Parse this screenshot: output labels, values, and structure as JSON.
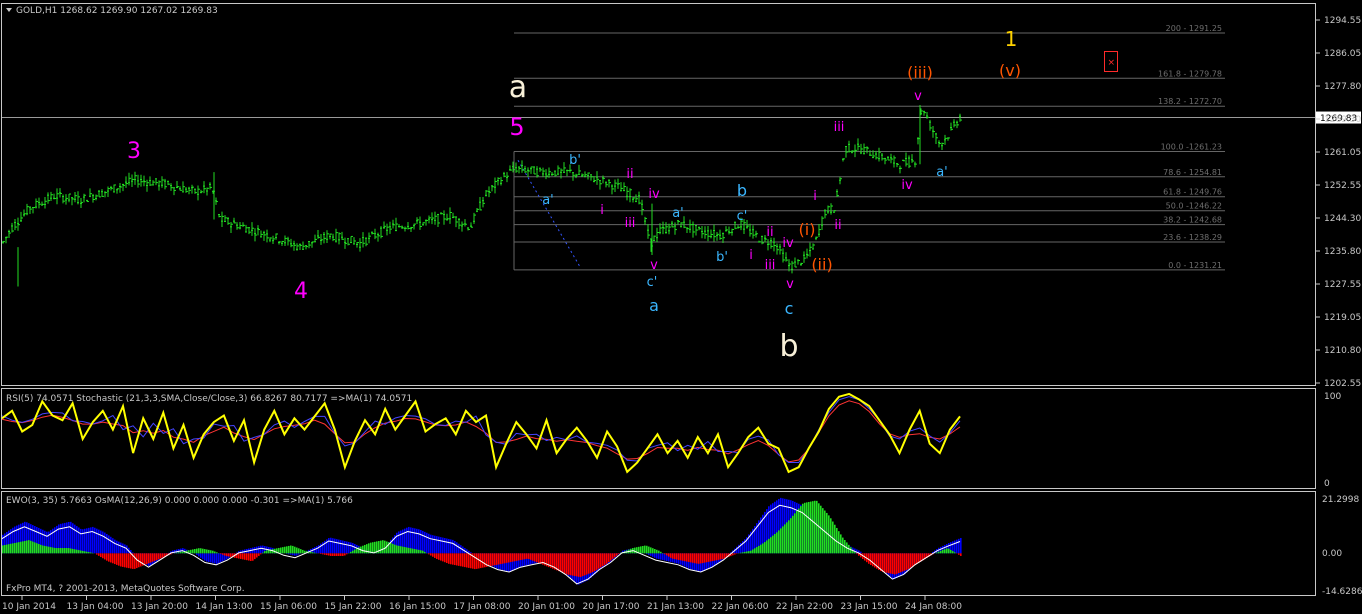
{
  "colors": {
    "background": "#000000",
    "frame": "#c8c8c8",
    "text": "#c8c8c8",
    "candle": "#22dd22",
    "fib_line": "#666666",
    "fib_text": "#6e6e6e",
    "rsi_line": "#ffff00",
    "stoch_main": "#4444ff",
    "stoch_signal": "#ff3333",
    "ewo_blue": "#0000ff",
    "ewo_green": "#22dd22",
    "ewo_red": "#ff0000",
    "ewo_line": "#ffffff",
    "magenta": "#ff00ff",
    "cyan": "#3ab6ff",
    "white": "#f8f0d8",
    "orange": "#ff5500",
    "yellow": "#ffd200",
    "close_marker": "#ff2a2a"
  },
  "symbol_header": "GOLD,H1  1268.62 1269.90 1267.02 1269.83",
  "price_axis": {
    "ticks": [
      "1294.55",
      "1286.05",
      "1277.80",
      "1269.30",
      "1261.05",
      "1252.55",
      "1244.30",
      "1235.80",
      "1227.55",
      "1219.05",
      "1210.80",
      "1202.55"
    ],
    "current_price": "1269.83"
  },
  "time_axis": [
    "10 Jan 2014",
    "13 Jan 04:00",
    "13 Jan 20:00",
    "14 Jan 13:00",
    "15 Jan 06:00",
    "15 Jan 22:00",
    "16 Jan 15:00",
    "17 Jan 08:00",
    "20 Jan 01:00",
    "20 Jan 17:00",
    "21 Jan 13:00",
    "22 Jan 06:00",
    "22 Jan 22:00",
    "23 Jan 15:00",
    "24 Jan 08:00"
  ],
  "fib_levels": [
    "200 - 1291.25",
    "161.8 - 1279.78",
    "138.2 - 1272.70",
    "100.0 -1261.23",
    "78.6 - 1254.81",
    "61.8 - 1249.76",
    "50.0 -1246.22",
    "38.2 - 1242.68",
    "23.6 - 1238.29",
    "0.0 - 1231.21"
  ],
  "wave_labels": [
    {
      "text": "3",
      "color": "magenta",
      "size": 22
    },
    {
      "text": "4",
      "color": "magenta",
      "size": 22
    },
    {
      "text": "a",
      "color": "white",
      "size": 30
    },
    {
      "text": "5",
      "color": "magenta",
      "size": 24
    },
    {
      "text": "a'",
      "color": "cyan",
      "size": 13
    },
    {
      "text": "b'",
      "color": "cyan",
      "size": 13
    },
    {
      "text": "i",
      "color": "magenta",
      "size": 13
    },
    {
      "text": "ii",
      "color": "magenta",
      "size": 13
    },
    {
      "text": "iii",
      "color": "magenta",
      "size": 13
    },
    {
      "text": "iv",
      "color": "magenta",
      "size": 13
    },
    {
      "text": "v",
      "color": "magenta",
      "size": 13
    },
    {
      "text": "c'",
      "color": "cyan",
      "size": 13
    },
    {
      "text": "a",
      "color": "cyan",
      "size": 16
    },
    {
      "text": "a'",
      "color": "cyan",
      "size": 13
    },
    {
      "text": "b",
      "color": "cyan",
      "size": 16
    },
    {
      "text": "c'",
      "color": "cyan",
      "size": 13
    },
    {
      "text": "b'",
      "color": "cyan",
      "size": 13
    },
    {
      "text": "i",
      "color": "magenta",
      "size": 13
    },
    {
      "text": "ii",
      "color": "magenta",
      "size": 13
    },
    {
      "text": "iii",
      "color": "magenta",
      "size": 13
    },
    {
      "text": "iv",
      "color": "magenta",
      "size": 13
    },
    {
      "text": "v",
      "color": "magenta",
      "size": 13
    },
    {
      "text": "c",
      "color": "cyan",
      "size": 16
    },
    {
      "text": "b",
      "color": "white",
      "size": 30
    },
    {
      "text": "(i)",
      "color": "orange",
      "size": 16
    },
    {
      "text": "(ii)",
      "color": "orange",
      "size": 16
    },
    {
      "text": "i",
      "color": "magenta",
      "size": 13
    },
    {
      "text": "ii",
      "color": "magenta",
      "size": 13
    },
    {
      "text": "iii",
      "color": "magenta",
      "size": 13
    },
    {
      "text": "iv",
      "color": "magenta",
      "size": 13
    },
    {
      "text": "v",
      "color": "magenta",
      "size": 13
    },
    {
      "text": "(iii)",
      "color": "orange",
      "size": 16
    },
    {
      "text": "a'",
      "color": "cyan",
      "size": 13
    },
    {
      "text": "1",
      "color": "yellow",
      "size": 20
    },
    {
      "text": "(v)",
      "color": "orange",
      "size": 16
    }
  ],
  "indicators": {
    "rsi_header": "RSI(5) 74.0571  Stochastic (21,3,3,SMA,Close/Close,3) 66.8267 80.7177  =>MA(1) 74.0571",
    "rsi_axis": [
      "100",
      "0"
    ],
    "ewo_header": "EWO(3, 35) 5.7663  OsMA(12,26,9) 0.000 0.000 0.000 -0.301  =>MA(1) 5.766",
    "ewo_axis": [
      "21.2998",
      "0.00",
      "-14.6286"
    ]
  },
  "copyright": "FxPro MT4, ? 2001-2013, MetaQuotes Software Corp.",
  "chart_data": {
    "type": "line",
    "title": "GOLD,H1",
    "ylim": [
      1202.55,
      1294.55
    ],
    "x": [
      "10 Jan 2014",
      "13 Jan 04:00",
      "13 Jan 20:00",
      "14 Jan 13:00",
      "15 Jan 06:00",
      "15 Jan 22:00",
      "16 Jan 15:00",
      "17 Jan 08:00",
      "20 Jan 01:00",
      "20 Jan 17:00",
      "21 Jan 13:00",
      "22 Jan 06:00",
      "22 Jan 22:00",
      "23 Jan 15:00",
      "24 Jan 08:00"
    ],
    "series": [
      {
        "name": "GOLD,H1",
        "values": [
          1237,
          1250,
          1253,
          1244,
          1238,
          1242,
          1244,
          1241,
          1256,
          1253,
          1238,
          1243,
          1233,
          1262,
          1266
        ]
      }
    ],
    "price_path": [
      [
        0,
        1237
      ],
      [
        12,
        1242
      ],
      [
        30,
        1247
      ],
      [
        55,
        1250
      ],
      [
        80,
        1249
      ],
      [
        105,
        1251
      ],
      [
        135,
        1254
      ],
      [
        165,
        1253
      ],
      [
        195,
        1251
      ],
      [
        212,
        1252
      ],
      [
        220,
        1244
      ],
      [
        245,
        1242
      ],
      [
        280,
        1239
      ],
      [
        300,
        1237
      ],
      [
        330,
        1240
      ],
      [
        360,
        1238
      ],
      [
        390,
        1242
      ],
      [
        420,
        1243
      ],
      [
        450,
        1245
      ],
      [
        470,
        1242
      ],
      [
        485,
        1250
      ],
      [
        500,
        1254
      ],
      [
        515,
        1257
      ],
      [
        540,
        1256
      ],
      [
        570,
        1256
      ],
      [
        600,
        1254
      ],
      [
        620,
        1252
      ],
      [
        640,
        1249
      ],
      [
        650,
        1238
      ],
      [
        660,
        1241
      ],
      [
        680,
        1243
      ],
      [
        700,
        1241
      ],
      [
        720,
        1240
      ],
      [
        740,
        1243
      ],
      [
        760,
        1239
      ],
      [
        775,
        1238
      ],
      [
        790,
        1232
      ],
      [
        805,
        1234
      ],
      [
        815,
        1238
      ],
      [
        825,
        1246
      ],
      [
        835,
        1247
      ],
      [
        845,
        1262
      ],
      [
        860,
        1262
      ],
      [
        880,
        1260
      ],
      [
        900,
        1258
      ],
      [
        915,
        1259
      ],
      [
        922,
        1273
      ],
      [
        930,
        1268
      ],
      [
        940,
        1263
      ],
      [
        950,
        1266
      ],
      [
        960,
        1270
      ]
    ],
    "fib_values": [
      1291.25,
      1279.78,
      1272.7,
      1261.23,
      1254.81,
      1249.76,
      1246.22,
      1242.68,
      1238.29,
      1231.21
    ],
    "rsi": [
      72,
      80,
      58,
      65,
      90,
      75,
      70,
      88,
      50,
      68,
      80,
      60,
      85,
      35,
      72,
      50,
      78,
      40,
      65,
      30,
      55,
      68,
      75,
      48,
      70,
      25,
      60,
      80,
      55,
      72,
      60,
      74,
      88,
      60,
      20,
      48,
      70,
      55,
      82,
      60,
      75,
      90,
      58,
      66,
      72,
      55,
      80,
      68,
      75,
      20,
      45,
      68,
      55,
      40,
      70,
      35,
      50,
      62,
      48,
      30,
      58,
      42,
      15,
      25,
      40,
      55,
      35,
      48,
      30,
      52,
      35,
      55,
      20,
      35,
      52,
      62,
      45,
      40,
      15,
      20,
      40,
      58,
      82,
      95,
      98,
      92,
      85,
      70,
      55,
      35,
      60,
      80,
      45,
      35,
      60,
      74
    ],
    "ewo": [
      7,
      10,
      12,
      10,
      8,
      11,
      12,
      9,
      10,
      8,
      5,
      3,
      -2,
      -5,
      -2,
      1,
      2,
      0,
      -3,
      -4,
      -2,
      1,
      2,
      3,
      2,
      0,
      -1,
      1,
      3,
      6,
      5,
      4,
      2,
      1,
      3,
      8,
      10,
      9,
      7,
      6,
      5,
      2,
      -1,
      -4,
      -6,
      -7,
      -5,
      -4,
      -3,
      -5,
      -8,
      -12,
      -10,
      -6,
      -3,
      1,
      2,
      0,
      -2,
      -3,
      -4,
      -6,
      -7,
      -5,
      -2,
      2,
      6,
      12,
      18,
      21,
      20,
      18,
      14,
      10,
      6,
      3,
      1,
      -2,
      -6,
      -10,
      -8,
      -4,
      -1,
      2,
      4,
      5.8
    ],
    "osma": [
      3,
      4,
      5,
      3,
      2,
      2,
      1,
      0,
      -3,
      -5,
      -6,
      -4,
      -2,
      0,
      1,
      2,
      1,
      -1,
      -2,
      -3,
      1,
      2,
      3,
      1,
      0,
      -1,
      -1,
      2,
      4,
      5,
      3,
      2,
      1,
      -2,
      -4,
      -5,
      -6,
      -5,
      -4,
      -3,
      -2,
      -4,
      -6,
      -8,
      -9,
      -7,
      -4,
      0,
      2,
      3,
      1,
      -2,
      -3,
      -4,
      -3,
      -2,
      0,
      1,
      4,
      8,
      13,
      19,
      20,
      14,
      6,
      0,
      -4,
      -7,
      -8,
      -6,
      -3,
      0,
      2,
      -1
    ]
  }
}
